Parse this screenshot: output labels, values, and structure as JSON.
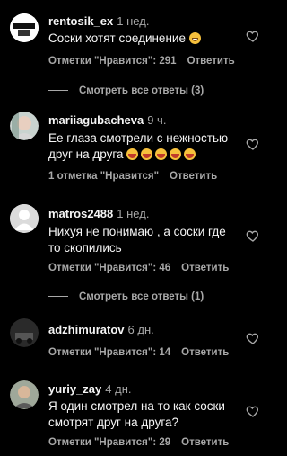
{
  "comments": [
    {
      "username": "rentosik_ex",
      "time": "1 нед.",
      "text": "Соски хотят соединение",
      "likes": "Отметки \"Нравится\": 291",
      "reply_label": "Ответить",
      "avatar_icon": "tatarin-logo-avatar",
      "emojis": [
        "grin"
      ]
    },
    {
      "username": "mariiagubacheva",
      "time": "9 ч.",
      "text_line1": "Ее глаза смотрели с нежностью",
      "text_line2": "друг на друга",
      "likes": "1 отметка \"Нравится\"",
      "reply_label": "Ответить",
      "avatar_icon": "woman-photo-avatar",
      "emojis": [
        "laugh",
        "laugh",
        "laugh",
        "laugh",
        "laugh"
      ]
    },
    {
      "username": "matros2488",
      "time": "1 нед.",
      "text_line1": "Нихуя не понимаю , а соски где",
      "text_line2": "то скопились",
      "likes": "Отметки \"Нравится\": 46",
      "reply_label": "Ответить",
      "avatar_icon": "default-user-avatar"
    },
    {
      "username": "adzhimuratov",
      "time": "6 дн.",
      "likes": "Отметки \"Нравится\": 14",
      "reply_label": "Ответить",
      "avatar_icon": "dark-photo-avatar"
    },
    {
      "username": "yuriy_zay",
      "time": "4 дн.",
      "text_line1": "Я один смотрел на то как соски",
      "text_line2": "смотрят друг на друга?",
      "likes": "Отметки \"Нравится\": 29",
      "reply_label": "Ответить",
      "avatar_icon": "man-photo-avatar"
    }
  ],
  "view_replies": [
    "Смотреть все ответы (3)",
    "Смотреть все ответы (1)"
  ],
  "colors": {
    "background": "#000000",
    "primary_text": "#f5f5f5",
    "secondary_text": "#a8a8a8",
    "emoji_yellow": "#f6c03c"
  }
}
